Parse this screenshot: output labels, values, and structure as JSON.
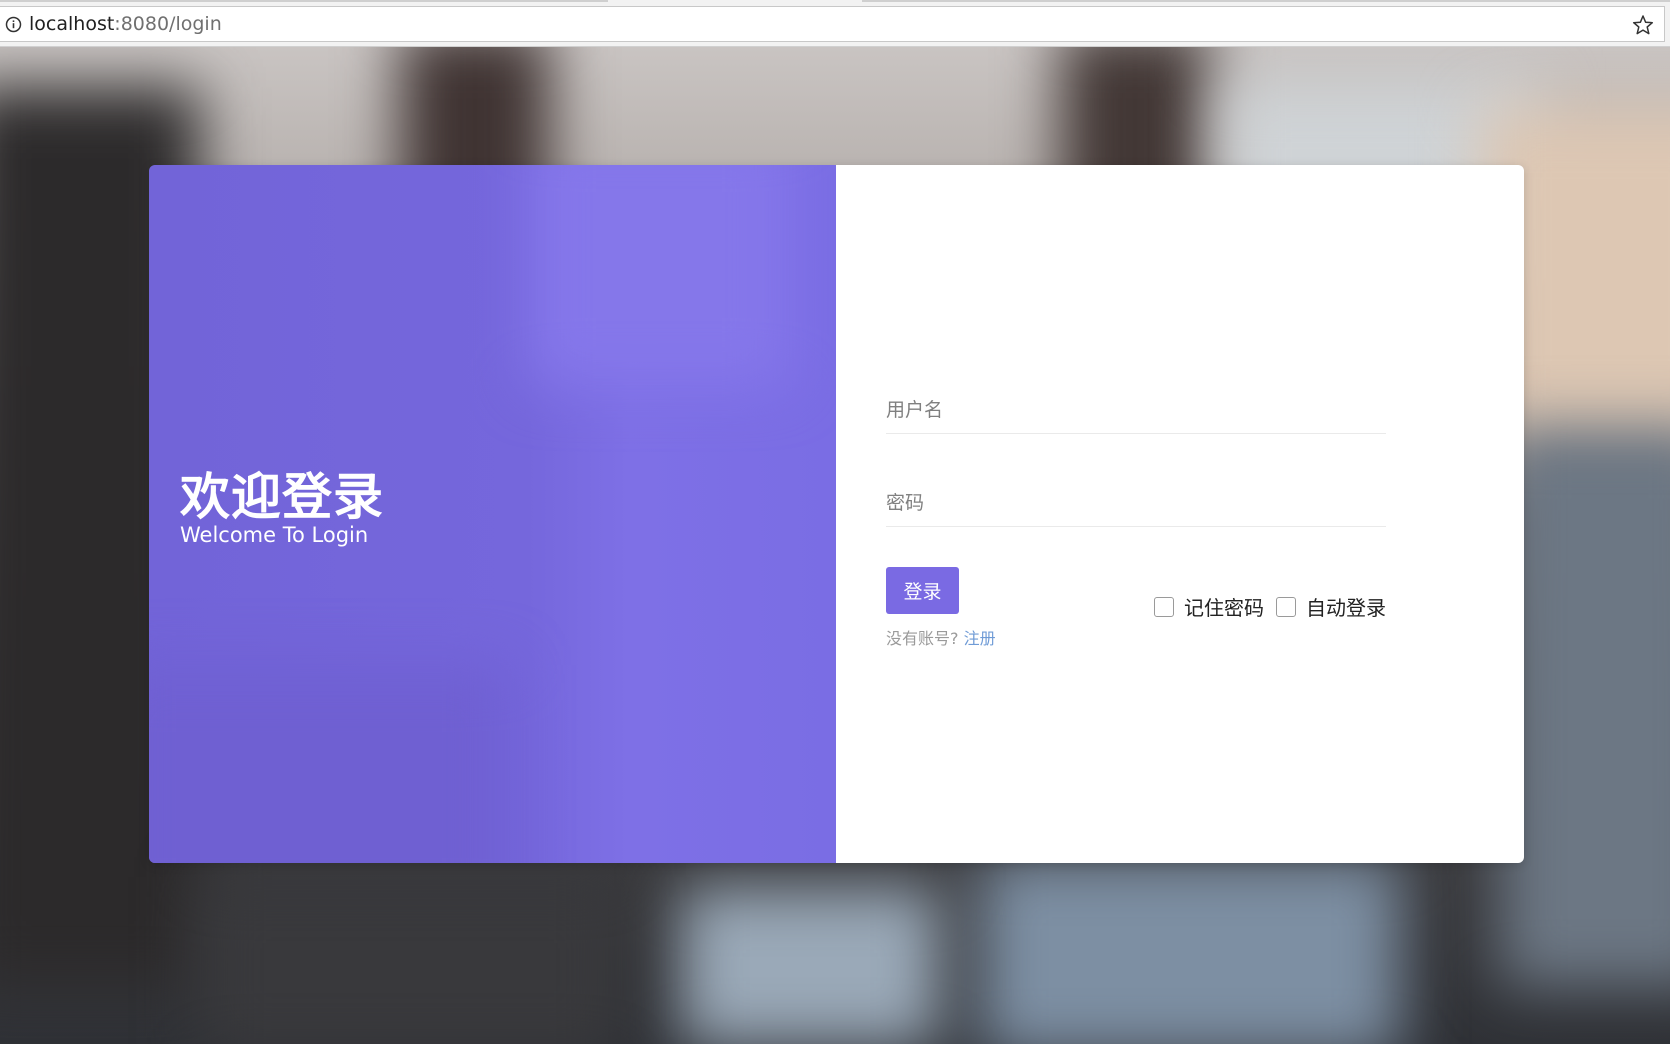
{
  "browser": {
    "url_host": "localhost",
    "url_rest": ":8080/login"
  },
  "welcome": {
    "title": "欢迎登录",
    "subtitle": "Welcome To Login"
  },
  "form": {
    "username_placeholder": "用户名",
    "password_placeholder": "密码",
    "login_label": "登录",
    "register_prompt": "没有账号?",
    "register_link": "注册",
    "remember_label": "记住密码",
    "auto_login_label": "自动登录"
  },
  "colors": {
    "accent": "#7a6ae3",
    "left_panel": "#7567dc",
    "link": "#6f9bd6"
  },
  "icons": {
    "info": "info-icon",
    "bookmark": "star-icon"
  }
}
